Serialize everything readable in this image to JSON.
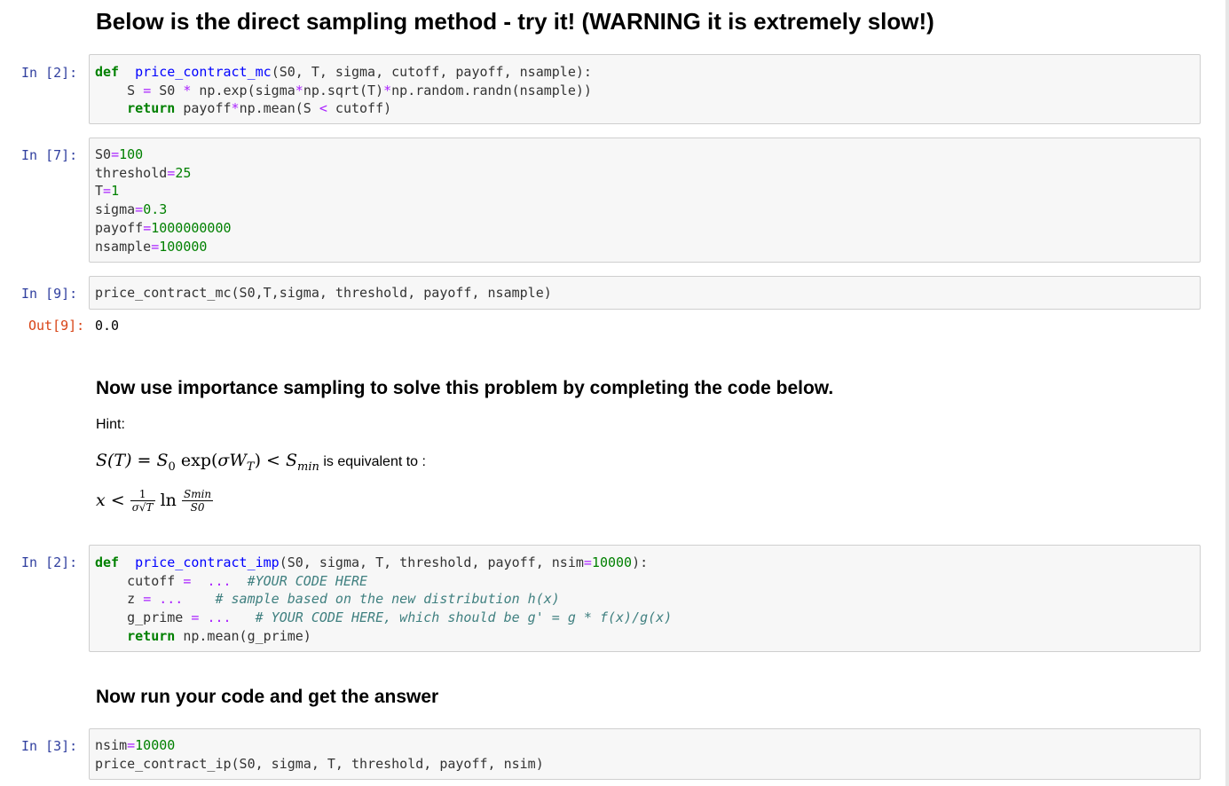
{
  "headings": {
    "direct": "Below is the direct sampling method - try it! (WARNING it is extremely slow!)",
    "importance": "Now use importance sampling to solve this problem by completing the code below.",
    "run": "Now run your code and get the answer"
  },
  "hint": {
    "label": "Hint:",
    "equivalent_suffix": " is equivalent to :",
    "math1": {
      "lhs": "S(T)",
      "eq": " = ",
      "s0": "S",
      "s0_sub": "0",
      "exp": " exp(",
      "sigma_w": "σW",
      "w_sub": "T",
      "close": ") < ",
      "smin": "S",
      "smin_sub": "min"
    },
    "math2": {
      "x": "x",
      "lt": " < ",
      "frac1_top": "1",
      "frac1_bot": "σ√T",
      "ln": " ln ",
      "frac2_top": "Smin",
      "frac2_bot": "S0"
    }
  },
  "cells": [
    {
      "prompt": "In  [2]:",
      "lines": [
        [
          [
            "kw",
            "def"
          ],
          [
            "",
            "  "
          ],
          [
            "fn",
            "price_contract_mc"
          ],
          [
            "",
            "(S0, T, sigma, cutoff, payoff, nsample):"
          ]
        ],
        [
          [
            "",
            "    S "
          ],
          [
            "op",
            "="
          ],
          [
            "",
            " S0 "
          ],
          [
            "op",
            "*"
          ],
          [
            "",
            " np.exp(sigma"
          ],
          [
            "op",
            "*"
          ],
          [
            "",
            "np.sqrt(T)"
          ],
          [
            "op",
            "*"
          ],
          [
            "",
            "np.random.randn(nsample))"
          ]
        ],
        [
          [
            "",
            "    "
          ],
          [
            "kw",
            "return"
          ],
          [
            "",
            " payoff"
          ],
          [
            "op",
            "*"
          ],
          [
            "",
            "np.mean(S "
          ],
          [
            "op",
            "<"
          ],
          [
            "",
            " cutoff)"
          ]
        ]
      ]
    },
    {
      "prompt": "In  [7]:",
      "lines": [
        [
          [
            "",
            "S0"
          ],
          [
            "op",
            "="
          ],
          [
            "num",
            "100"
          ]
        ],
        [
          [
            "",
            "threshold"
          ],
          [
            "op",
            "="
          ],
          [
            "num",
            "25"
          ]
        ],
        [
          [
            "",
            "T"
          ],
          [
            "op",
            "="
          ],
          [
            "num",
            "1"
          ]
        ],
        [
          [
            "",
            "sigma"
          ],
          [
            "op",
            "="
          ],
          [
            "num",
            "0.3"
          ]
        ],
        [
          [
            "",
            "payoff"
          ],
          [
            "op",
            "="
          ],
          [
            "num",
            "1000000000"
          ]
        ],
        [
          [
            "",
            "nsample"
          ],
          [
            "op",
            "="
          ],
          [
            "num",
            "100000"
          ]
        ]
      ]
    },
    {
      "prompt": "In  [9]:",
      "lines": [
        [
          [
            "",
            "price_contract_mc(S0,T,sigma, threshold, payoff, nsample)"
          ]
        ]
      ]
    },
    {
      "prompt": "In  [2]:",
      "lines": [
        [
          [
            "kw",
            "def"
          ],
          [
            "",
            "  "
          ],
          [
            "fn",
            "price_contract_imp"
          ],
          [
            "",
            "(S0, sigma, T, threshold, payoff, nsim"
          ],
          [
            "op",
            "="
          ],
          [
            "num",
            "10000"
          ],
          [
            "",
            "):"
          ]
        ],
        [
          [
            "",
            "    cutoff "
          ],
          [
            "op",
            "="
          ],
          [
            "",
            "  "
          ],
          [
            "op",
            "..."
          ],
          [
            "",
            "  "
          ],
          [
            "cm",
            "#YOUR CODE HERE"
          ]
        ],
        [
          [
            "",
            "    z "
          ],
          [
            "op",
            "="
          ],
          [
            "",
            " "
          ],
          [
            "op",
            "..."
          ],
          [
            "",
            "    "
          ],
          [
            "cm",
            "# sample based on the new distribution h(x)"
          ]
        ],
        [
          [
            "",
            "    g_prime "
          ],
          [
            "op",
            "="
          ],
          [
            "",
            " "
          ],
          [
            "op",
            "..."
          ],
          [
            "",
            "   "
          ],
          [
            "cm",
            "# YOUR CODE HERE, which should be g' = g * f(x)/g(x)"
          ]
        ],
        [
          [
            "",
            "    "
          ],
          [
            "kw",
            "return"
          ],
          [
            "",
            " np.mean(g_prime)"
          ]
        ]
      ]
    },
    {
      "prompt": "In  [3]:",
      "lines": [
        [
          [
            "",
            "nsim"
          ],
          [
            "op",
            "="
          ],
          [
            "num",
            "10000"
          ]
        ],
        [
          [
            "",
            "price_contract_ip(S0, sigma, T, threshold, payoff, nsim)"
          ]
        ]
      ]
    }
  ],
  "output": {
    "prompt": "Out[9]:",
    "value": "0.0"
  }
}
